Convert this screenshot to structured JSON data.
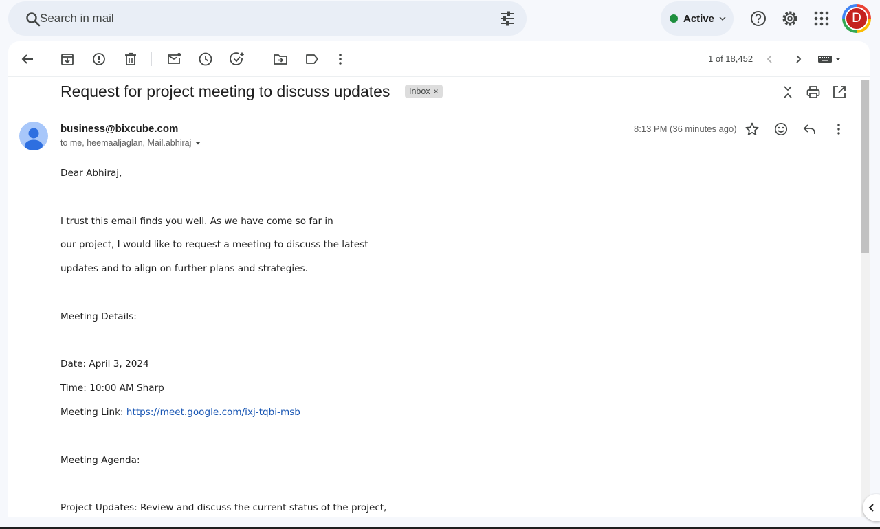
{
  "search": {
    "placeholder": "Search in mail"
  },
  "status": {
    "label": "Active",
    "color": "#1e8e3e"
  },
  "account": {
    "initial": "D"
  },
  "toolbar": {
    "counter": "1 of 18,452"
  },
  "email": {
    "subject": "Request for project meeting to discuss updates",
    "label_chip": "Inbox",
    "label_chip_remove": "×",
    "sender": "business@bixcube.com",
    "recipients": "to me, heemaaljaglan, Mail.abhiraj",
    "time": "8:13 PM (36 minutes ago)",
    "body": {
      "greeting": "Dear Abhiraj,",
      "p1_l1": "I trust this email finds you well. As we have come so far in",
      "p1_l2": "our project, I would like to request a meeting to discuss the latest",
      "p1_l3": "updates and to align on further plans and strategies.",
      "details_heading": "Meeting Details:",
      "date": "Date: April 3, 2024",
      "time": "Time: 10:00 AM Sharp",
      "link_label": "Meeting Link: ",
      "link_url": "https://meet.google.com/ixj-tqbi-msb",
      "agenda_heading": "Meeting Agenda:",
      "agenda_l1": "Project Updates: Review and discuss the current status of the project,"
    }
  },
  "colors": {
    "background": "#f6f8fc",
    "search_bg": "#e9eef6",
    "link": "#1a57b4",
    "avatar": "#c5221f"
  }
}
